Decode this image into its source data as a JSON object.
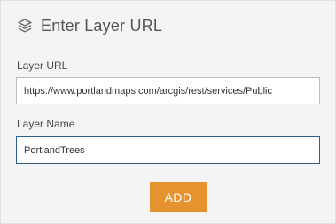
{
  "header": {
    "icon": "layers-icon",
    "title": "Enter Layer URL"
  },
  "form": {
    "url_label": "Layer URL",
    "url_value": "https://www.portlandmaps.com/arcgis/rest/services/Public",
    "name_label": "Layer Name",
    "name_value": "PortlandTrees",
    "add_button": "ADD"
  },
  "colors": {
    "accent": "#e5932e",
    "focus_border": "#2d5e8d",
    "panel_bg": "#f4f4f4"
  }
}
